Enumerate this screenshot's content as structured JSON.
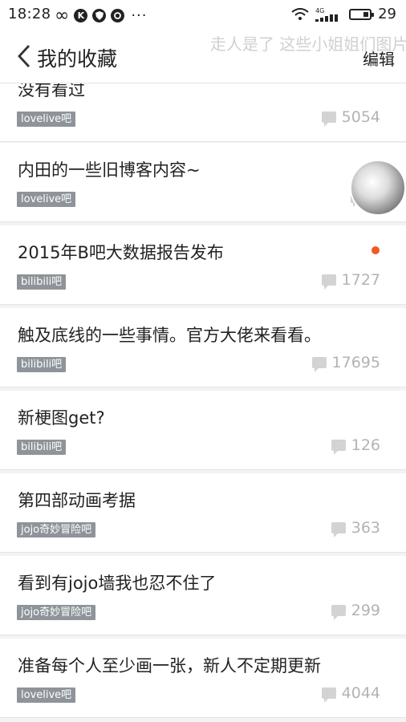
{
  "status_bar": {
    "time": "18:28",
    "infinity": "∞",
    "icon_k": "K",
    "more": "···",
    "network_label": "4G",
    "battery": "29"
  },
  "header": {
    "title": "我的收藏",
    "edit_label": "编辑",
    "ghost_text": "走人是了 这些小姐姐们图片备"
  },
  "items": [
    {
      "title": "没有看过",
      "tag": "lovelive吧",
      "count": "5054",
      "unread": false
    },
    {
      "title": "内田的一些旧博客内容~",
      "tag": "lovelive吧",
      "count": "2",
      "unread": false
    },
    {
      "title": "2015年B吧大数据报告发布",
      "tag": "bilibili吧",
      "count": "1727",
      "unread": true
    },
    {
      "title": "触及底线的一些事情。官方大佬来看看。",
      "tag": "bilibili吧",
      "count": "17695",
      "unread": false
    },
    {
      "title": "新梗图get?",
      "tag": "bilibili吧",
      "count": "126",
      "unread": false
    },
    {
      "title": "第四部动画考据",
      "tag": "jojo奇妙冒险吧",
      "count": "363",
      "unread": false
    },
    {
      "title": "看到有jojo墙我也忍不住了",
      "tag": "jojo奇妙冒险吧",
      "count": "299",
      "unread": false
    },
    {
      "title": "准备每个人至少画一张，新人不定期更新",
      "tag": "lovelive吧",
      "count": "4044",
      "unread": false
    }
  ],
  "colors": {
    "tag_bg": "#8e9499",
    "unread_dot": "#f05a24",
    "count_text": "#b3b3b3"
  }
}
